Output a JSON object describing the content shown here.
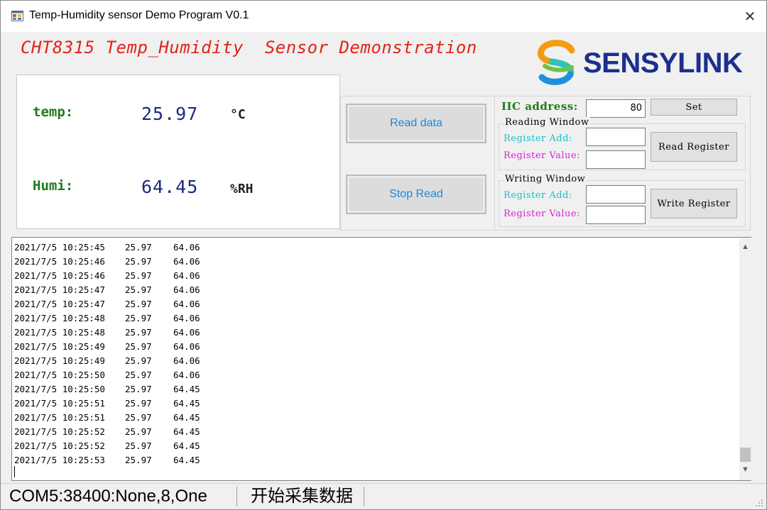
{
  "window": {
    "title": "Temp-Humidity sensor Demo Program V0.1",
    "close_symbol": "✕"
  },
  "banner": {
    "title": "CHT8315 Temp_Humidity  Sensor Demonstration",
    "logo_text": "SENSYLINK"
  },
  "readout": {
    "temp_label": "temp:",
    "temp_value": "25.97",
    "temp_unit": "°C",
    "humi_label": "Humi:",
    "humi_value": "64.45",
    "humi_unit": "%RH"
  },
  "controls": {
    "read_data_label": "Read data",
    "stop_read_label": "Stop Read",
    "iic_label": "IIC address:",
    "iic_value": "80",
    "set_label": "Set",
    "reading_window": {
      "title": "Reading Window",
      "reg_add_label": "Register Add:",
      "reg_add_value": "",
      "reg_value_label": "Register Value:",
      "reg_value_value": "",
      "button_label": "Read Register"
    },
    "writing_window": {
      "title": "Writing Window",
      "reg_add_label": "Register Add:",
      "reg_add_value": "",
      "reg_value_label": "Register Value:",
      "reg_value_value": "",
      "button_label": "Write Register"
    }
  },
  "log": {
    "rows": [
      [
        "2021/7/5 10:25:45",
        "25.97",
        "64.06"
      ],
      [
        "2021/7/5 10:25:46",
        "25.97",
        "64.06"
      ],
      [
        "2021/7/5 10:25:46",
        "25.97",
        "64.06"
      ],
      [
        "2021/7/5 10:25:47",
        "25.97",
        "64.06"
      ],
      [
        "2021/7/5 10:25:47",
        "25.97",
        "64.06"
      ],
      [
        "2021/7/5 10:25:48",
        "25.97",
        "64.06"
      ],
      [
        "2021/7/5 10:25:48",
        "25.97",
        "64.06"
      ],
      [
        "2021/7/5 10:25:49",
        "25.97",
        "64.06"
      ],
      [
        "2021/7/5 10:25:49",
        "25.97",
        "64.06"
      ],
      [
        "2021/7/5 10:25:50",
        "25.97",
        "64.06"
      ],
      [
        "2021/7/5 10:25:50",
        "25.97",
        "64.45"
      ],
      [
        "2021/7/5 10:25:51",
        "25.97",
        "64.45"
      ],
      [
        "2021/7/5 10:25:51",
        "25.97",
        "64.45"
      ],
      [
        "2021/7/5 10:25:52",
        "25.97",
        "64.45"
      ],
      [
        "2021/7/5 10:25:52",
        "25.97",
        "64.45"
      ],
      [
        "2021/7/5 10:25:53",
        "25.97",
        "64.45"
      ]
    ]
  },
  "status": {
    "port": "COM5:38400:None,8,One",
    "state": "开始采集数据"
  },
  "colors": {
    "banner_red": "#e2231a",
    "label_green": "#1e7b1e",
    "value_navy": "#1c2a7a",
    "button_text_blue": "#1e88d8",
    "cyan": "#19c0c8",
    "magenta": "#e01be0",
    "logo_navy": "#1c2f8c"
  },
  "icons": {
    "app": "app-window-icon",
    "close": "close-icon",
    "logo": "sensylink-s-logo-icon"
  }
}
